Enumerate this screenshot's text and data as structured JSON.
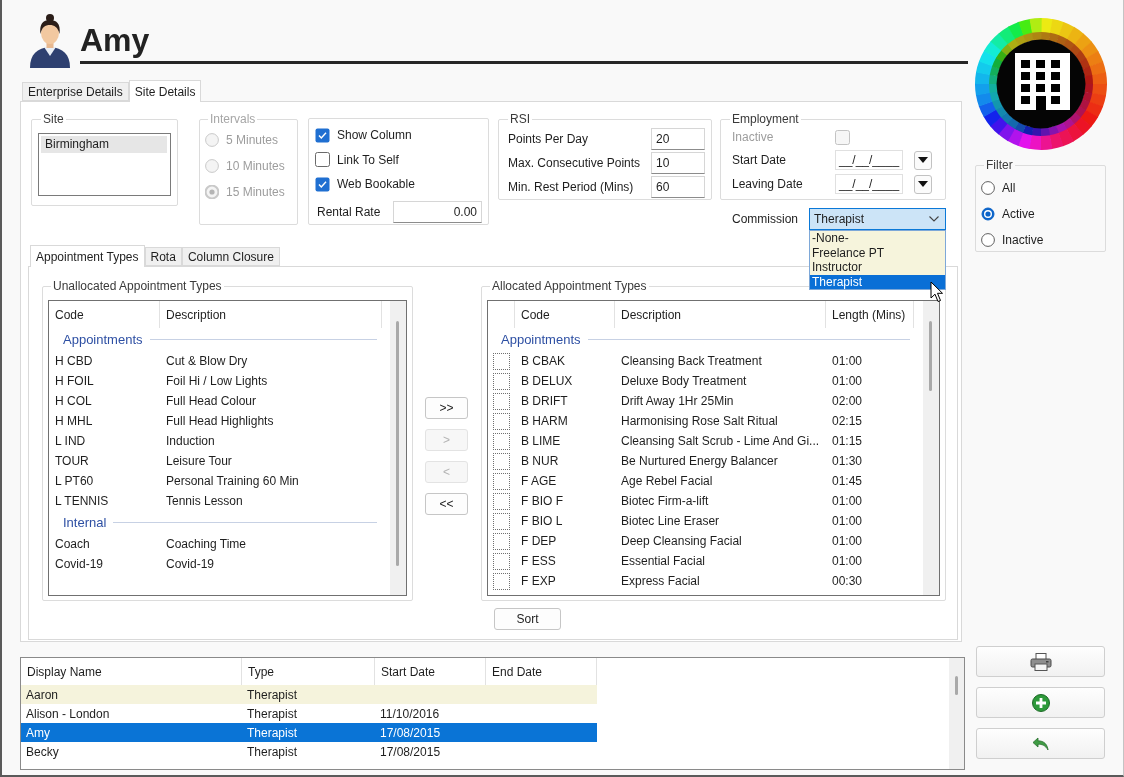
{
  "header": {
    "name": "Amy"
  },
  "tabs": [
    {
      "label": "Enterprise Details",
      "selected": false
    },
    {
      "label": "Site Details",
      "selected": true
    }
  ],
  "site": {
    "title": "Site",
    "items": [
      {
        "label": "Birmingham",
        "selected": true
      }
    ]
  },
  "intervals": {
    "title": "Intervals",
    "disabled": true,
    "options": [
      {
        "label": "5 Minutes",
        "selected": false
      },
      {
        "label": "10 Minutes",
        "selected": false
      },
      {
        "label": "15 Minutes",
        "selected": true
      }
    ]
  },
  "settings": {
    "checkboxes": [
      {
        "label": "Show Column",
        "checked": true
      },
      {
        "label": "Link To Self",
        "checked": false
      },
      {
        "label": "Web Bookable",
        "checked": true
      }
    ],
    "rental_rate": {
      "label": "Rental Rate",
      "value": "0.00"
    }
  },
  "rsi": {
    "title": "RSI",
    "fields": [
      {
        "label": "Points Per Day",
        "value": "20"
      },
      {
        "label": "Max. Consecutive Points",
        "value": "10"
      },
      {
        "label": "Min. Rest Period (Mins)",
        "value": "60"
      }
    ]
  },
  "employment": {
    "title": "Employment",
    "inactive": {
      "label": "Inactive",
      "checked": false,
      "disabled": true
    },
    "dates": [
      {
        "label": "Start Date",
        "value": "__/__/____"
      },
      {
        "label": "Leaving Date",
        "value": "__/__/____"
      }
    ]
  },
  "commission": {
    "label": "Commission",
    "value": "Therapist",
    "expanded": true,
    "options": [
      {
        "label": "-None-",
        "selected": false
      },
      {
        "label": "Freelance PT",
        "selected": false
      },
      {
        "label": "Instructor",
        "selected": false
      },
      {
        "label": "Therapist",
        "selected": true
      }
    ]
  },
  "sub_tabs": [
    {
      "label": "Appointment Types",
      "selected": true
    },
    {
      "label": "Rota",
      "selected": false
    },
    {
      "label": "Column Closure",
      "selected": false
    }
  ],
  "unallocated": {
    "title": "Unallocated Appointment Types",
    "columns": [
      "Code",
      "Description"
    ],
    "groups": [
      {
        "title": "Appointments",
        "rows": [
          {
            "code": "H CBD",
            "description": "Cut & Blow Dry"
          },
          {
            "code": "H FOIL",
            "description": "Foil Hi / Low Lights"
          },
          {
            "code": "H COL",
            "description": "Full Head Colour"
          },
          {
            "code": "H MHL",
            "description": "Full Head Highlights"
          },
          {
            "code": "L IND",
            "description": "Induction"
          },
          {
            "code": "TOUR",
            "description": "Leisure Tour"
          },
          {
            "code": "L PT60",
            "description": "Personal Training 60 Min"
          },
          {
            "code": "L TENNIS",
            "description": "Tennis Lesson"
          }
        ]
      },
      {
        "title": "Internal",
        "rows": [
          {
            "code": "Coach",
            "description": "Coaching Time"
          },
          {
            "code": "Covid-19",
            "description": "Covid-19"
          }
        ]
      }
    ]
  },
  "transfer_buttons": [
    {
      "label": ">>",
      "disabled": false
    },
    {
      "label": ">",
      "disabled": true
    },
    {
      "label": "<",
      "disabled": true
    },
    {
      "label": "<<",
      "disabled": false
    }
  ],
  "allocated": {
    "title": "Allocated Appointment Types",
    "columns": [
      "Code",
      "Description",
      "Length (Mins)"
    ],
    "groups": [
      {
        "title": "Appointments",
        "rows": [
          {
            "checked": false,
            "code": "B CBAK",
            "description": "Cleansing Back Treatment",
            "length": "01:00"
          },
          {
            "checked": false,
            "code": "B DELUX",
            "description": "Deluxe Body Treatment",
            "length": "01:00"
          },
          {
            "checked": false,
            "code": "B DRIFT",
            "description": "Drift Away 1Hr 25Min",
            "length": "02:00"
          },
          {
            "checked": false,
            "code": "B HARM",
            "description": "Harmonising Rose Salt Ritual",
            "length": "02:15"
          },
          {
            "checked": false,
            "code": "B LIME",
            "description": "Cleansing Salt Scrub - Lime And Gi...",
            "length": "01:15"
          },
          {
            "checked": false,
            "code": "B NUR",
            "description": "Be Nurtured Energy Balancer",
            "length": "01:30"
          },
          {
            "checked": false,
            "code": "F AGE",
            "description": "Age Rebel Facial",
            "length": "01:45"
          },
          {
            "checked": false,
            "code": "F BIO F",
            "description": "Biotec Firm-a-lift",
            "length": "01:00"
          },
          {
            "checked": false,
            "code": "F BIO L",
            "description": "Biotec Line Eraser",
            "length": "01:00"
          },
          {
            "checked": false,
            "code": "F DEP",
            "description": "Deep Cleansing Facial",
            "length": "01:00"
          },
          {
            "checked": false,
            "code": "F ESS",
            "description": "Essential Facial",
            "length": "01:00"
          },
          {
            "checked": false,
            "code": "F EXP",
            "description": "Express Facial",
            "length": "00:30"
          }
        ]
      }
    ]
  },
  "sort_button": {
    "label": "Sort"
  },
  "staff_table": {
    "columns": [
      "Display Name",
      "Type",
      "Start Date",
      "End Date"
    ],
    "rows": [
      {
        "display_name": "Aaron",
        "type": "Therapist",
        "highlighted": true,
        "selected": false
      },
      {
        "display_name": "Alison - London",
        "type": "Therapist",
        "start_date": "11/10/2016",
        "highlighted": false,
        "selected": false
      },
      {
        "display_name": "Amy",
        "type": "Therapist",
        "start_date": "17/08/2015",
        "highlighted": false,
        "selected": true
      },
      {
        "display_name": "Becky",
        "type": "Therapist",
        "start_date": "17/08/2015",
        "highlighted": false,
        "selected": false
      }
    ]
  },
  "filter": {
    "title": "Filter",
    "options": [
      {
        "label": "All",
        "selected": false
      },
      {
        "label": "Active",
        "selected": true
      },
      {
        "label": "Inactive",
        "selected": false
      }
    ]
  },
  "actions": [
    {
      "kind": "print"
    },
    {
      "kind": "add"
    },
    {
      "kind": "undo"
    }
  ]
}
